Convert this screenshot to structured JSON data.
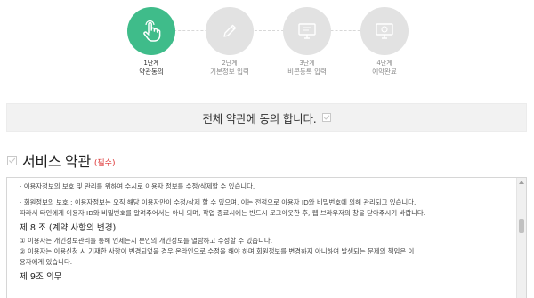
{
  "steps": [
    {
      "num": "1단계",
      "label": "약관동의",
      "icon": "pointer-hand-icon",
      "active": true
    },
    {
      "num": "2단계",
      "label": "기본정보 입력",
      "icon": "pencil-icon",
      "active": false
    },
    {
      "num": "3단계",
      "label": "비콘등록 입력",
      "icon": "monitor-icon",
      "active": false
    },
    {
      "num": "4단계",
      "label": "예약완료",
      "icon": "monitor-check-icon",
      "active": false
    }
  ],
  "agree_all": {
    "label": "전체 약관에 동의 합니다."
  },
  "section": {
    "title": "서비스 약관",
    "required": "(필수)"
  },
  "terms": {
    "line1": "· 이용자정보의 보호 및 관리를 위하여 수시로 이용자 정보를 수정/삭제할 수 있습니다.",
    "line2": "· 회원정보의 보호 : 이용자정보는 오직 해당 이용자만이 수정/삭제 할 수 있으며, 이는 전적으로 이용자 ID와 비밀번호에 의해 관리되고 있습니다.",
    "line3": "따라서 타인에게 이용자 ID와 비밀번호를 알려주어서는 아니 되며, 작업 종료시에는 반드시 로그아웃한 후, 웹 브라우저의 창을 닫아주시기 바랍니다.",
    "article8_title": "제 8 조 (계약 사항의 변경)",
    "article8_1": "① 이용자는 개인정보관리를 통해 언제든지 본인의 개인정보를 열람하고 수정할 수 있습니다.",
    "article8_2": "② 이용자는 이용신청 시 기재한 사항이 변경되었을 경우 온라인으로 수정을 해야 하며 회원정보를 변경하지 아니하여 발생되는 문제의 책임은 이",
    "article8_3": "용자에게 있습니다.",
    "article9_title": "제 9조 의무"
  },
  "colors": {
    "active_step": "#3fbc8a",
    "inactive_step": "#e2e2e2",
    "required": "#dd3333"
  }
}
